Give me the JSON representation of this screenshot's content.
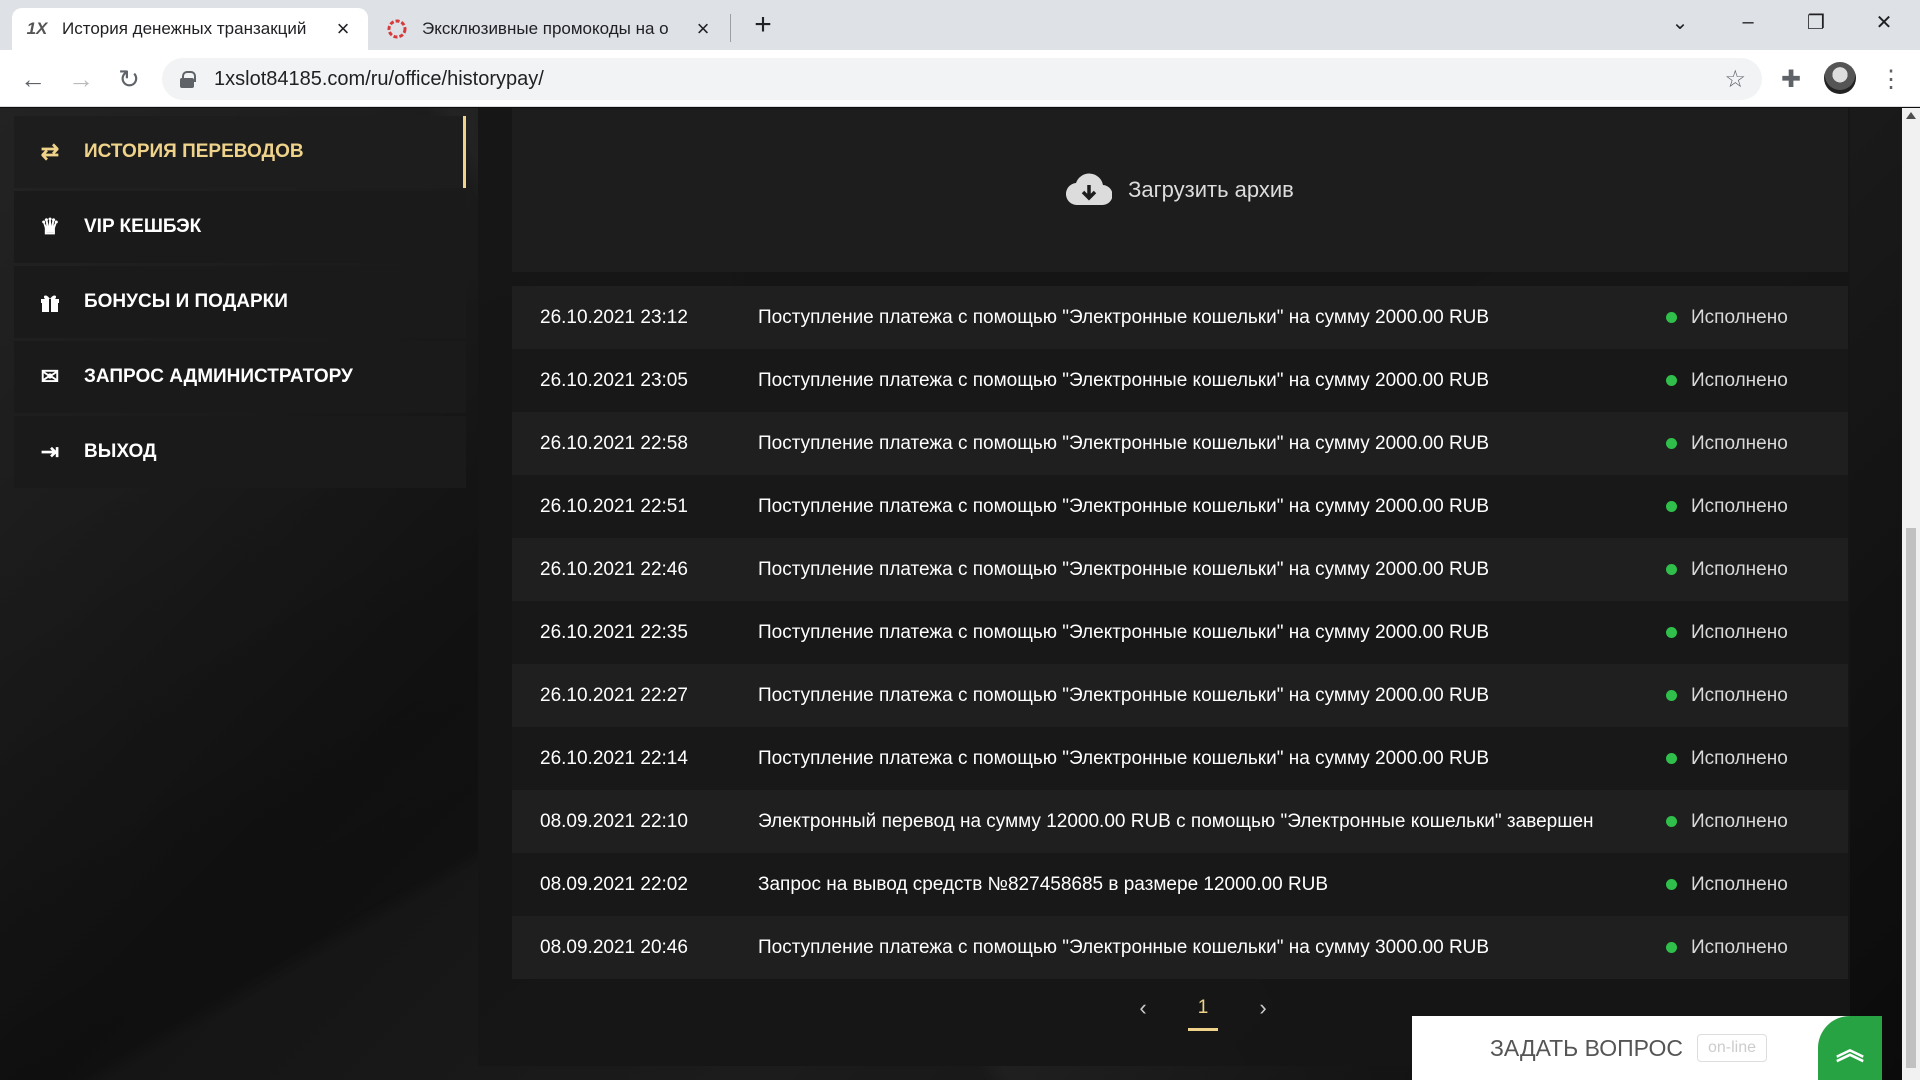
{
  "browser": {
    "tabs": [
      {
        "title": "История денежных транзакций",
        "favicon": "1X",
        "active": true
      },
      {
        "title": "Эксклюзивные промокоды на о",
        "favicon": "ring-logo",
        "active": false
      }
    ],
    "url": "1xslot84185.com/ru/office/historypay/"
  },
  "sidebar": {
    "items": [
      {
        "label": "ИСТОРИЯ ПЕРЕВОДОВ",
        "icon": "transfer-arrows-icon",
        "active": true
      },
      {
        "label": "VIP КЕШБЭК",
        "icon": "crown-icon"
      },
      {
        "label": "БОНУСЫ И ПОДАРКИ",
        "icon": "gift-icon"
      },
      {
        "label": "ЗАПРОС АДМИНИСТРАТОРУ",
        "icon": "envelope-icon"
      },
      {
        "label": "ВЫХОД",
        "icon": "logout-icon"
      }
    ]
  },
  "archive": {
    "label": "Загрузить архив"
  },
  "transactions": [
    {
      "date": "26.10.2021 23:12",
      "desc": "Поступление платежа с помощью \"Электронные кошельки\" на сумму 2000.00 RUB",
      "status": "Исполнено"
    },
    {
      "date": "26.10.2021 23:05",
      "desc": "Поступление платежа с помощью \"Электронные кошельки\" на сумму 2000.00 RUB",
      "status": "Исполнено"
    },
    {
      "date": "26.10.2021 22:58",
      "desc": "Поступление платежа с помощью \"Электронные кошельки\" на сумму 2000.00 RUB",
      "status": "Исполнено"
    },
    {
      "date": "26.10.2021 22:51",
      "desc": "Поступление платежа с помощью \"Электронные кошельки\" на сумму 2000.00 RUB",
      "status": "Исполнено"
    },
    {
      "date": "26.10.2021 22:46",
      "desc": "Поступление платежа с помощью \"Электронные кошельки\" на сумму 2000.00 RUB",
      "status": "Исполнено"
    },
    {
      "date": "26.10.2021 22:35",
      "desc": "Поступление платежа с помощью \"Электронные кошельки\" на сумму 2000.00 RUB",
      "status": "Исполнено"
    },
    {
      "date": "26.10.2021 22:27",
      "desc": "Поступление платежа с помощью \"Электронные кошельки\" на сумму 2000.00 RUB",
      "status": "Исполнено"
    },
    {
      "date": "26.10.2021 22:14",
      "desc": "Поступление платежа с помощью \"Электронные кошельки\" на сумму 2000.00 RUB",
      "status": "Исполнено"
    },
    {
      "date": "08.09.2021 22:10",
      "desc": "Электронный перевод на сумму 12000.00 RUB с помощью \"Электронные кошельки\" завершен",
      "status": "Исполнено"
    },
    {
      "date": "08.09.2021 22:02",
      "desc": "Запрос на вывод средств №827458685 в размере 12000.00 RUB",
      "status": "Исполнено"
    },
    {
      "date": "08.09.2021 20:46",
      "desc": "Поступление платежа с помощью \"Электронные кошельки\" на сумму 3000.00 RUB",
      "status": "Исполнено"
    }
  ],
  "pagination": {
    "current": "1"
  },
  "ask": {
    "label": "ЗАДАТЬ ВОПРОС",
    "online": "on-line"
  },
  "colors": {
    "accent": "#f0d38a",
    "status_ok": "#2fbf4a",
    "chat_green": "#27a344"
  }
}
